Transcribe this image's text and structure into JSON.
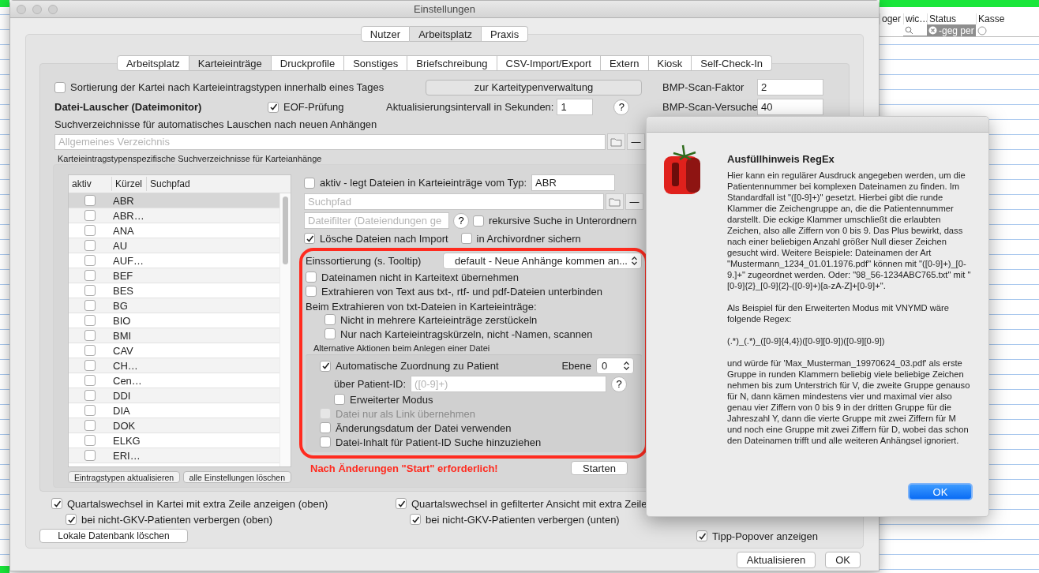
{
  "window": {
    "title": "Einstellungen"
  },
  "top_tabs": [
    {
      "label": "Nutzer",
      "selected": false
    },
    {
      "label": "Arbeitsplatz",
      "selected": true
    },
    {
      "label": "Praxis",
      "selected": false
    }
  ],
  "sub_tabs": [
    {
      "label": "Arbeitsplatz",
      "selected": false
    },
    {
      "label": "Karteieinträge",
      "selected": true
    },
    {
      "label": "Druckprofile",
      "selected": false
    },
    {
      "label": "Sonstiges",
      "selected": false
    },
    {
      "label": "Briefschreibung",
      "selected": false
    },
    {
      "label": "CSV-Import/Export",
      "selected": false
    },
    {
      "label": "Extern",
      "selected": false
    },
    {
      "label": "Kiosk",
      "selected": false
    },
    {
      "label": "Self-Check-In",
      "selected": false
    }
  ],
  "general": {
    "sort_checkbox": {
      "label": "Sortierung der Kartei nach Karteieintragstypen innerhalb eines Tages",
      "checked": false
    },
    "types_button": "zur Karteitypenverwaltung",
    "monitor_heading": "Datei-Lauscher (Dateimonitor)",
    "eof_checkbox": {
      "label": "EOF-Prüfung",
      "checked": true
    },
    "interval": {
      "label": "Aktualisierungsintervall in Sekunden:",
      "value": "1"
    },
    "help": "?",
    "bmp_fields": [
      {
        "label": "BMP-Scan-Faktor",
        "value": "2"
      },
      {
        "label": "BMP-Scan-Versuche",
        "value": "40"
      }
    ],
    "search_dirs_label": "Suchverzeichnisse für automatisches Lauschen nach neuen Anhängen",
    "general_dir": {
      "placeholder": "Allgemeines Verzeichnis"
    },
    "minus": "—"
  },
  "type_dirs": {
    "title": "Karteieintragstypenspezifische Suchverzeichnisse für Karteianhänge",
    "table": {
      "columns": [
        "aktiv",
        "Kürzel",
        "Suchpfad"
      ],
      "rows": [
        {
          "code": "ABR",
          "active": false,
          "selected": true
        },
        {
          "code": "ABR…",
          "active": false,
          "selected": false
        },
        {
          "code": "ANA",
          "active": false,
          "selected": false
        },
        {
          "code": "AU",
          "active": false,
          "selected": false
        },
        {
          "code": "AUF…",
          "active": false,
          "selected": false
        },
        {
          "code": "BEF",
          "active": false,
          "selected": false
        },
        {
          "code": "BES",
          "active": false,
          "selected": false
        },
        {
          "code": "BG",
          "active": false,
          "selected": false
        },
        {
          "code": "BIO",
          "active": false,
          "selected": false
        },
        {
          "code": "BMI",
          "active": false,
          "selected": false
        },
        {
          "code": "CAV",
          "active": false,
          "selected": false
        },
        {
          "code": "CH…",
          "active": false,
          "selected": false
        },
        {
          "code": "Cen…",
          "active": false,
          "selected": false
        },
        {
          "code": "DDI",
          "active": false,
          "selected": false
        },
        {
          "code": "DIA",
          "active": false,
          "selected": false
        },
        {
          "code": "DOK",
          "active": false,
          "selected": false
        },
        {
          "code": "ELKG",
          "active": false,
          "selected": false
        },
        {
          "code": "ERI…",
          "active": false,
          "selected": false
        }
      ]
    },
    "buttons": [
      "Eintragstypen aktualisieren",
      "alle Einstellungen löschen"
    ],
    "detail": {
      "active": {
        "label": "aktiv - legt Dateien in Karteieinträge vom Typ:",
        "checked": false,
        "type_value": "ABR"
      },
      "path": {
        "placeholder": "Suchpfad"
      },
      "minus": "—",
      "filter": {
        "placeholder": "Dateifilter (Dateiendungen ge"
      },
      "help": "?",
      "recursive": {
        "label": "rekursive Suche in Unterordnern",
        "checked": false
      },
      "delete_after_import": {
        "label": "Lösche Dateien nach Import",
        "checked": true
      },
      "archive": {
        "label": "in Archivordner sichern",
        "checked": false
      },
      "sorting": {
        "label": "Einssortierung (s. Tooltip)",
        "value": "default - Neue Anhänge kommen an..."
      },
      "options": [
        {
          "label": "Dateinamen nicht in Karteitext übernehmen",
          "checked": false
        },
        {
          "label": "Extrahieren von Text aus txt-, rtf- und pdf-Dateien unterbinden",
          "checked": false
        }
      ],
      "extract_heading": "Beim Extrahieren von txt-Dateien in Karteieinträge:",
      "extract_options": [
        {
          "label": "Nicht in mehrere Karteieinträge zerstückeln",
          "checked": false
        },
        {
          "label": "Nur nach Karteieintragskürzeln, nicht -Namen, scannen",
          "checked": false
        }
      ],
      "alt_title": "Alternative Aktionen beim Anlegen einer Datei",
      "auto_assign": {
        "label": "Automatische Zuordnung zu Patient",
        "checked": true
      },
      "level": {
        "label": "Ebene",
        "value": "0"
      },
      "patient_id": {
        "label": "über Patient-ID:",
        "placeholder": "([0-9]+)"
      },
      "patient_help": "?",
      "extended": {
        "label": "Erweiterter Modus",
        "checked": false
      },
      "alt_options": [
        {
          "label": "Datei nur als Link übernehmen",
          "checked": false,
          "disabled": true
        },
        {
          "label": "Änderungsdatum der Datei verwenden",
          "checked": false,
          "disabled": false
        },
        {
          "label": "Datei-Inhalt für Patient-ID Suche hinzuziehen",
          "checked": false,
          "disabled": false
        }
      ],
      "warning": "Nach Änderungen \"Start\" erforderlich!",
      "start_button": "Starten"
    }
  },
  "quarter": [
    {
      "label": "Quartalswechsel in Kartei mit extra Zeile anzeigen (oben)",
      "checked": true,
      "children": [
        {
          "label": "bei nicht-GKV-Patienten verbergen (oben)",
          "checked": true
        }
      ]
    },
    {
      "label": "Quartalswechsel in gefilterter Ansicht mit extra Zeile",
      "checked": true,
      "children": [
        {
          "label": "bei nicht-GKV-Patienten verbergen (unten)",
          "checked": true
        }
      ]
    }
  ],
  "delete_db_button": "Lokale Datenbank löschen",
  "popover": {
    "label": "Tipp-Popover anzeigen",
    "checked": true
  },
  "footer_buttons": [
    "Aktualisieren",
    "OK"
  ],
  "dialog": {
    "title": "Ausfüllhinweis RegEx",
    "paragraphs": [
      "Hier kann ein regulärer Ausdruck angegeben werden, um die Patientennummer bei komplexen Dateinamen zu finden. Im Standardfall ist \"([0-9]+)\" gesetzt. Hierbei gibt die runde Klammer die Zeichengruppe an, die die Patientennummer darstellt. Die eckige Klammer umschließt die erlaubten Zeichen, also alle Ziffern von 0 bis 9. Das Plus bewirkt, dass nach einer beliebigen Anzahl größer Null dieser Zeichen gesucht wird. Weitere Beispiele: Dateinamen der Art \"Mustermann_1234_01.01.1976.pdf\" können mit \"([0-9]+)_[0-9.]+\" zugeordnet werden. Oder: \"98_56-1234ABC765.txt\" mit \"[0-9]{2}_[0-9]{2}-([0-9]+)[a-zA-Z]+[0-9]+\".",
      "Als Beispiel für den Erweiterten Modus mit VNYMD wäre folgende Regex:",
      "(.*)_(.*)_([0-9]{4,4})([0-9][0-9])([0-9][0-9])",
      "und würde für 'Max_Musterman_19970624_03.pdf' als erste Gruppe in runden Klammern beliebig viele beliebige Zeichen nehmen bis zum Unterstrich für V, die zweite Gruppe genauso für N, dann kämen mindestens vier und maximal vier also genau vier Ziffern von 0 bis 9 in der dritten Gruppe für die Jahreszahl Y, dann die vierte Gruppe mit zwei Ziffern für M und noch eine Gruppe mit zwei Ziffern für D, wobei das schon den Dateinamen trifft und alle weiteren Anhängsel ignoriert."
    ],
    "button": "OK"
  },
  "background_table": {
    "columns": [
      "oger",
      "wic…",
      "Status",
      "Kasse"
    ],
    "status_filter": "-geg per"
  }
}
